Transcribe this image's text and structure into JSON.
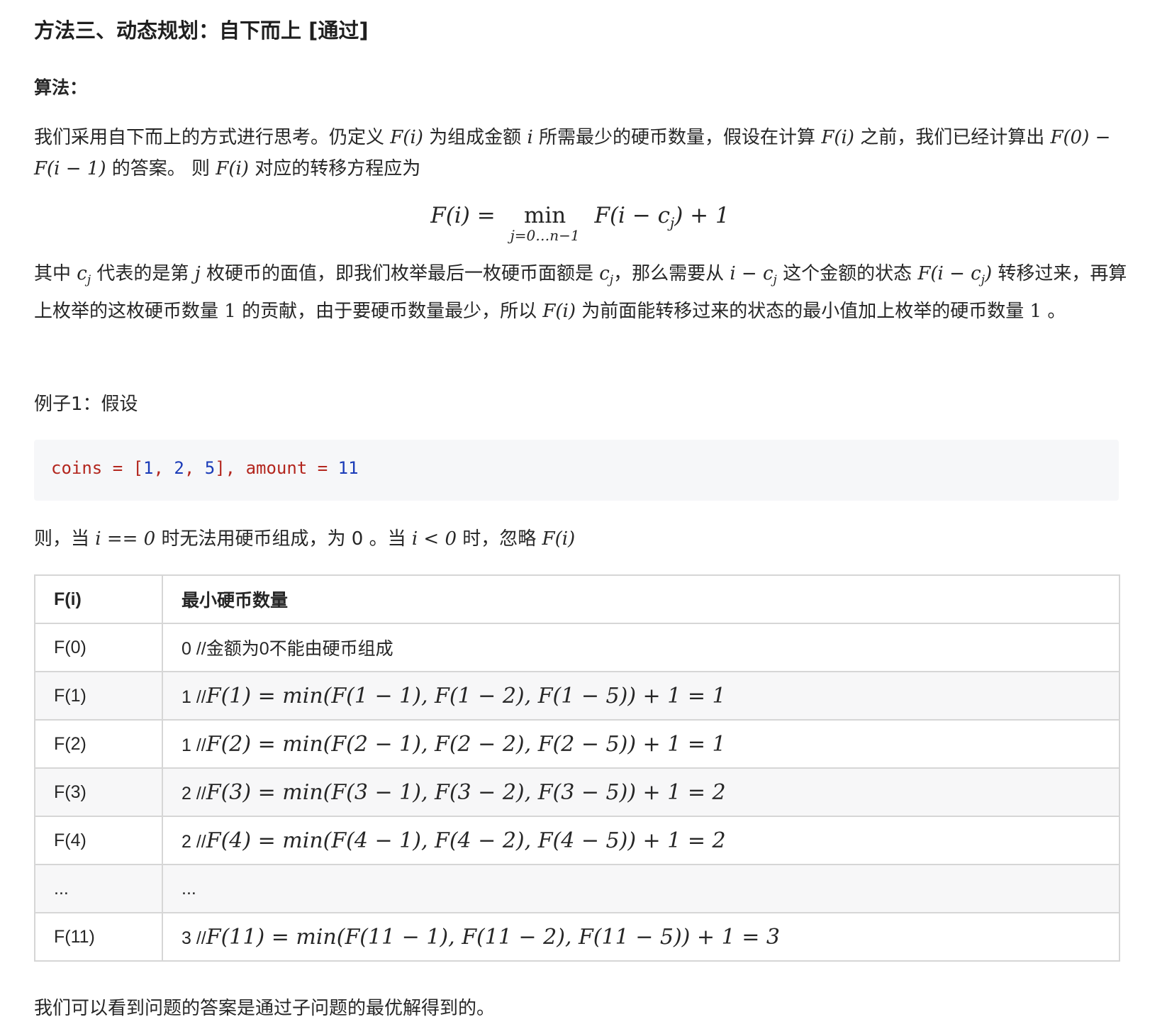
{
  "heading": "方法三、动态规划：自下而上 [通过]",
  "algorithm_label": "算法：",
  "para1": {
    "t1": "我们采用自下而上的方式进行思考。仍定义 ",
    "m1": "F(i)",
    "t2": " 为组成金额 ",
    "m2": "i",
    "t3": " 所需最少的硬币数量，假设在计算 ",
    "m3": "F(i)",
    "t4": " 之前，我们已经计算出 ",
    "m4": "F(0) − F(i − 1)",
    "t5": " 的答案。 则 ",
    "m5": "F(i)",
    "t6": " 对应的转移方程应为"
  },
  "formula": {
    "lhs": "F(i) =",
    "op": "min",
    "sub": "j=0…n−1",
    "rhs": "F(i − c",
    "rhs_sub": "j",
    "rhs_end": ") + 1"
  },
  "para2": {
    "t1": "其中 ",
    "m1": "c",
    "m1s": "j",
    "t2": " 代表的是第 ",
    "m2": "j",
    "t3": " 枚硬币的面值，即我们枚举最后一枚硬币面额是 ",
    "m3": "c",
    "m3s": "j",
    "t4": "，那么需要从 ",
    "m4": "i − c",
    "m4s": "j",
    "t5": " 这个金额的状态 ",
    "m5": "F(i − c",
    "m5s": "j",
    "m5e": ")",
    "t6": " 转移过来，再算上枚举的这枚硬币数量 ",
    "m6": "1",
    "t7": " 的贡献，由于要硬币数量最少，所以 ",
    "m7": "F(i)",
    "t8": " 为前面能转移过来的状态的最小值加上枚举的硬币数量 ",
    "m8": "1",
    "t9": " 。"
  },
  "example_label": "例子1：假设",
  "code": {
    "v1": "coins",
    "eq1": " = [",
    "n1": "1",
    "s1": ", ",
    "n2": "2",
    "s2": ", ",
    "n3": "5",
    "close": "], ",
    "v2": "amount",
    "eq2": " = ",
    "n4": "11"
  },
  "para3": {
    "t1": "则，当 ",
    "m1": "i == 0",
    "t2": " 时无法用硬币组成，为 0 。当 ",
    "m2": "i < 0",
    "t3": " 时，忽略 ",
    "m3": "F(i)"
  },
  "table": {
    "headers": [
      "F(i)",
      "最小硬币数量"
    ],
    "rows": [
      {
        "left": "F(0)",
        "value": "0",
        "note": "//金额为0不能由硬币组成",
        "math": ""
      },
      {
        "left": "F(1)",
        "value": "1",
        "note": "//",
        "math": "F(1) = min(F(1 − 1), F(1 − 2), F(1 − 5)) + 1 = 1"
      },
      {
        "left": "F(2)",
        "value": "1",
        "note": "//",
        "math": "F(2) = min(F(2 − 1), F(2 − 2), F(2 − 5)) + 1 = 1"
      },
      {
        "left": "F(3)",
        "value": "2",
        "note": "//",
        "math": "F(3) = min(F(3 − 1), F(3 − 2), F(3 − 5)) + 1 = 2"
      },
      {
        "left": "F(4)",
        "value": "2",
        "note": "//",
        "math": "F(4) = min(F(4 − 1), F(4 − 2), F(4 − 5)) + 1 = 2"
      },
      {
        "left": "...",
        "value": "...",
        "note": "",
        "math": ""
      },
      {
        "left": "F(11)",
        "value": "3",
        "note": "//",
        "math": "F(11) = min(F(11 − 1), F(11 − 2), F(11 − 5)) + 1 = 3"
      }
    ]
  },
  "conclusion": "我们可以看到问题的答案是通过子问题的最优解得到的。"
}
